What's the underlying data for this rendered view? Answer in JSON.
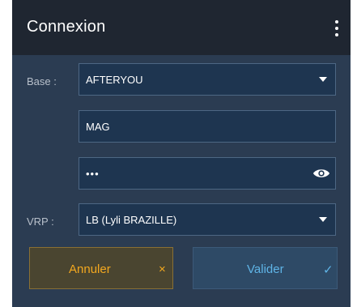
{
  "header": {
    "title": "Connexion",
    "menu_icon": "kebab-menu-icon"
  },
  "form": {
    "base": {
      "label": "Base :",
      "value": "AFTERYOU",
      "icon": "dropdown-caret-icon"
    },
    "username": {
      "value": "MAG"
    },
    "password": {
      "value": "•••",
      "icon": "eye-icon"
    },
    "vrp": {
      "label": "VRP :",
      "value": "LB (Lyli BRAZILLE)",
      "icon": "dropdown-caret-icon"
    }
  },
  "actions": {
    "cancel": {
      "label": "Annuler",
      "icon": "×",
      "color": "#f3a81f"
    },
    "ok": {
      "label": "Valider",
      "icon": "✓",
      "color": "#5fb4e6"
    }
  },
  "colors": {
    "header_bg": "#1f2631",
    "dialog_bg": "#2b3c52",
    "field_bg": "#1e3550"
  }
}
